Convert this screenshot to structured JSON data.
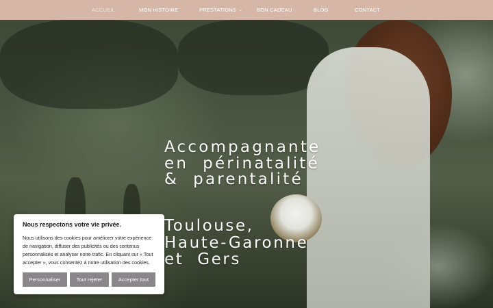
{
  "nav": {
    "items": [
      {
        "label": "ACCUEIL"
      },
      {
        "label": "MON HISTOIRE"
      },
      {
        "label": "PRESTATIONS"
      },
      {
        "label": "BON CADEAU"
      },
      {
        "label": "BLOG"
      },
      {
        "label": "CONTACT"
      }
    ],
    "dropdown_glyph": "⌄"
  },
  "hero": {
    "title_lines": [
      "Accompagnante",
      "en  périnatalité",
      "&  parentalité"
    ],
    "location_lines": [
      "Toulouse,",
      "Haute-Garonne",
      "et  Gers"
    ]
  },
  "cookie": {
    "title": "Nous respectons votre vie privée.",
    "text": "Nous utilisons des cookies pour améliorer votre expérience de navigation, diffuser des publicités ou des contenus personnalisés et analyser notre trafic. En cliquant sur « Tout accepter », vous consentez à notre utilisation des cookies.",
    "buttons": {
      "customize": "Personnaliser",
      "reject": "Tout rejeter",
      "accept": "Accepter tout"
    }
  },
  "colors": {
    "nav_bg": "#d6b7a7",
    "button_bg": "#8a8689"
  }
}
